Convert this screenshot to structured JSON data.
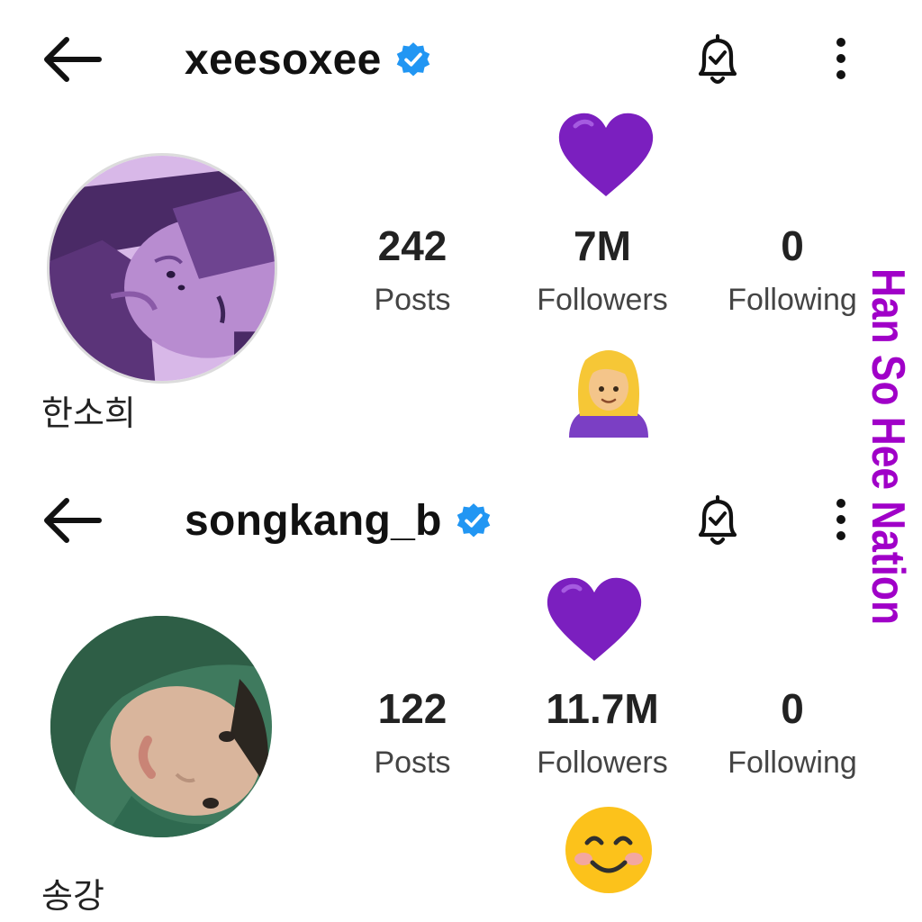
{
  "profiles": [
    {
      "username": "xeesoxee",
      "full_name": "한소희",
      "verified": true,
      "stats": [
        {
          "value": "242",
          "label": "Posts"
        },
        {
          "value": "7M",
          "label": "Followers"
        },
        {
          "value": "0",
          "label": "Following"
        }
      ]
    },
    {
      "username": "songkang_b",
      "full_name": "송강",
      "verified": true,
      "stats": [
        {
          "value": "122",
          "label": "Posts"
        },
        {
          "value": "11.7M",
          "label": "Followers"
        },
        {
          "value": "0",
          "label": "Following"
        }
      ]
    }
  ],
  "watermark": "Han So Hee Nation",
  "icons": {
    "back": "arrow-left-icon",
    "verified": "verified-badge-icon",
    "notifications": "bell-check-icon",
    "more": "more-vertical-icon",
    "heart": "purple-heart-emoji",
    "woman": "woman-blonde-emoji",
    "smile": "smiling-face-blush-emoji"
  },
  "colors": {
    "verified": "#2196f3",
    "heart": "#7b1fbf",
    "watermark": "#a000c8"
  }
}
